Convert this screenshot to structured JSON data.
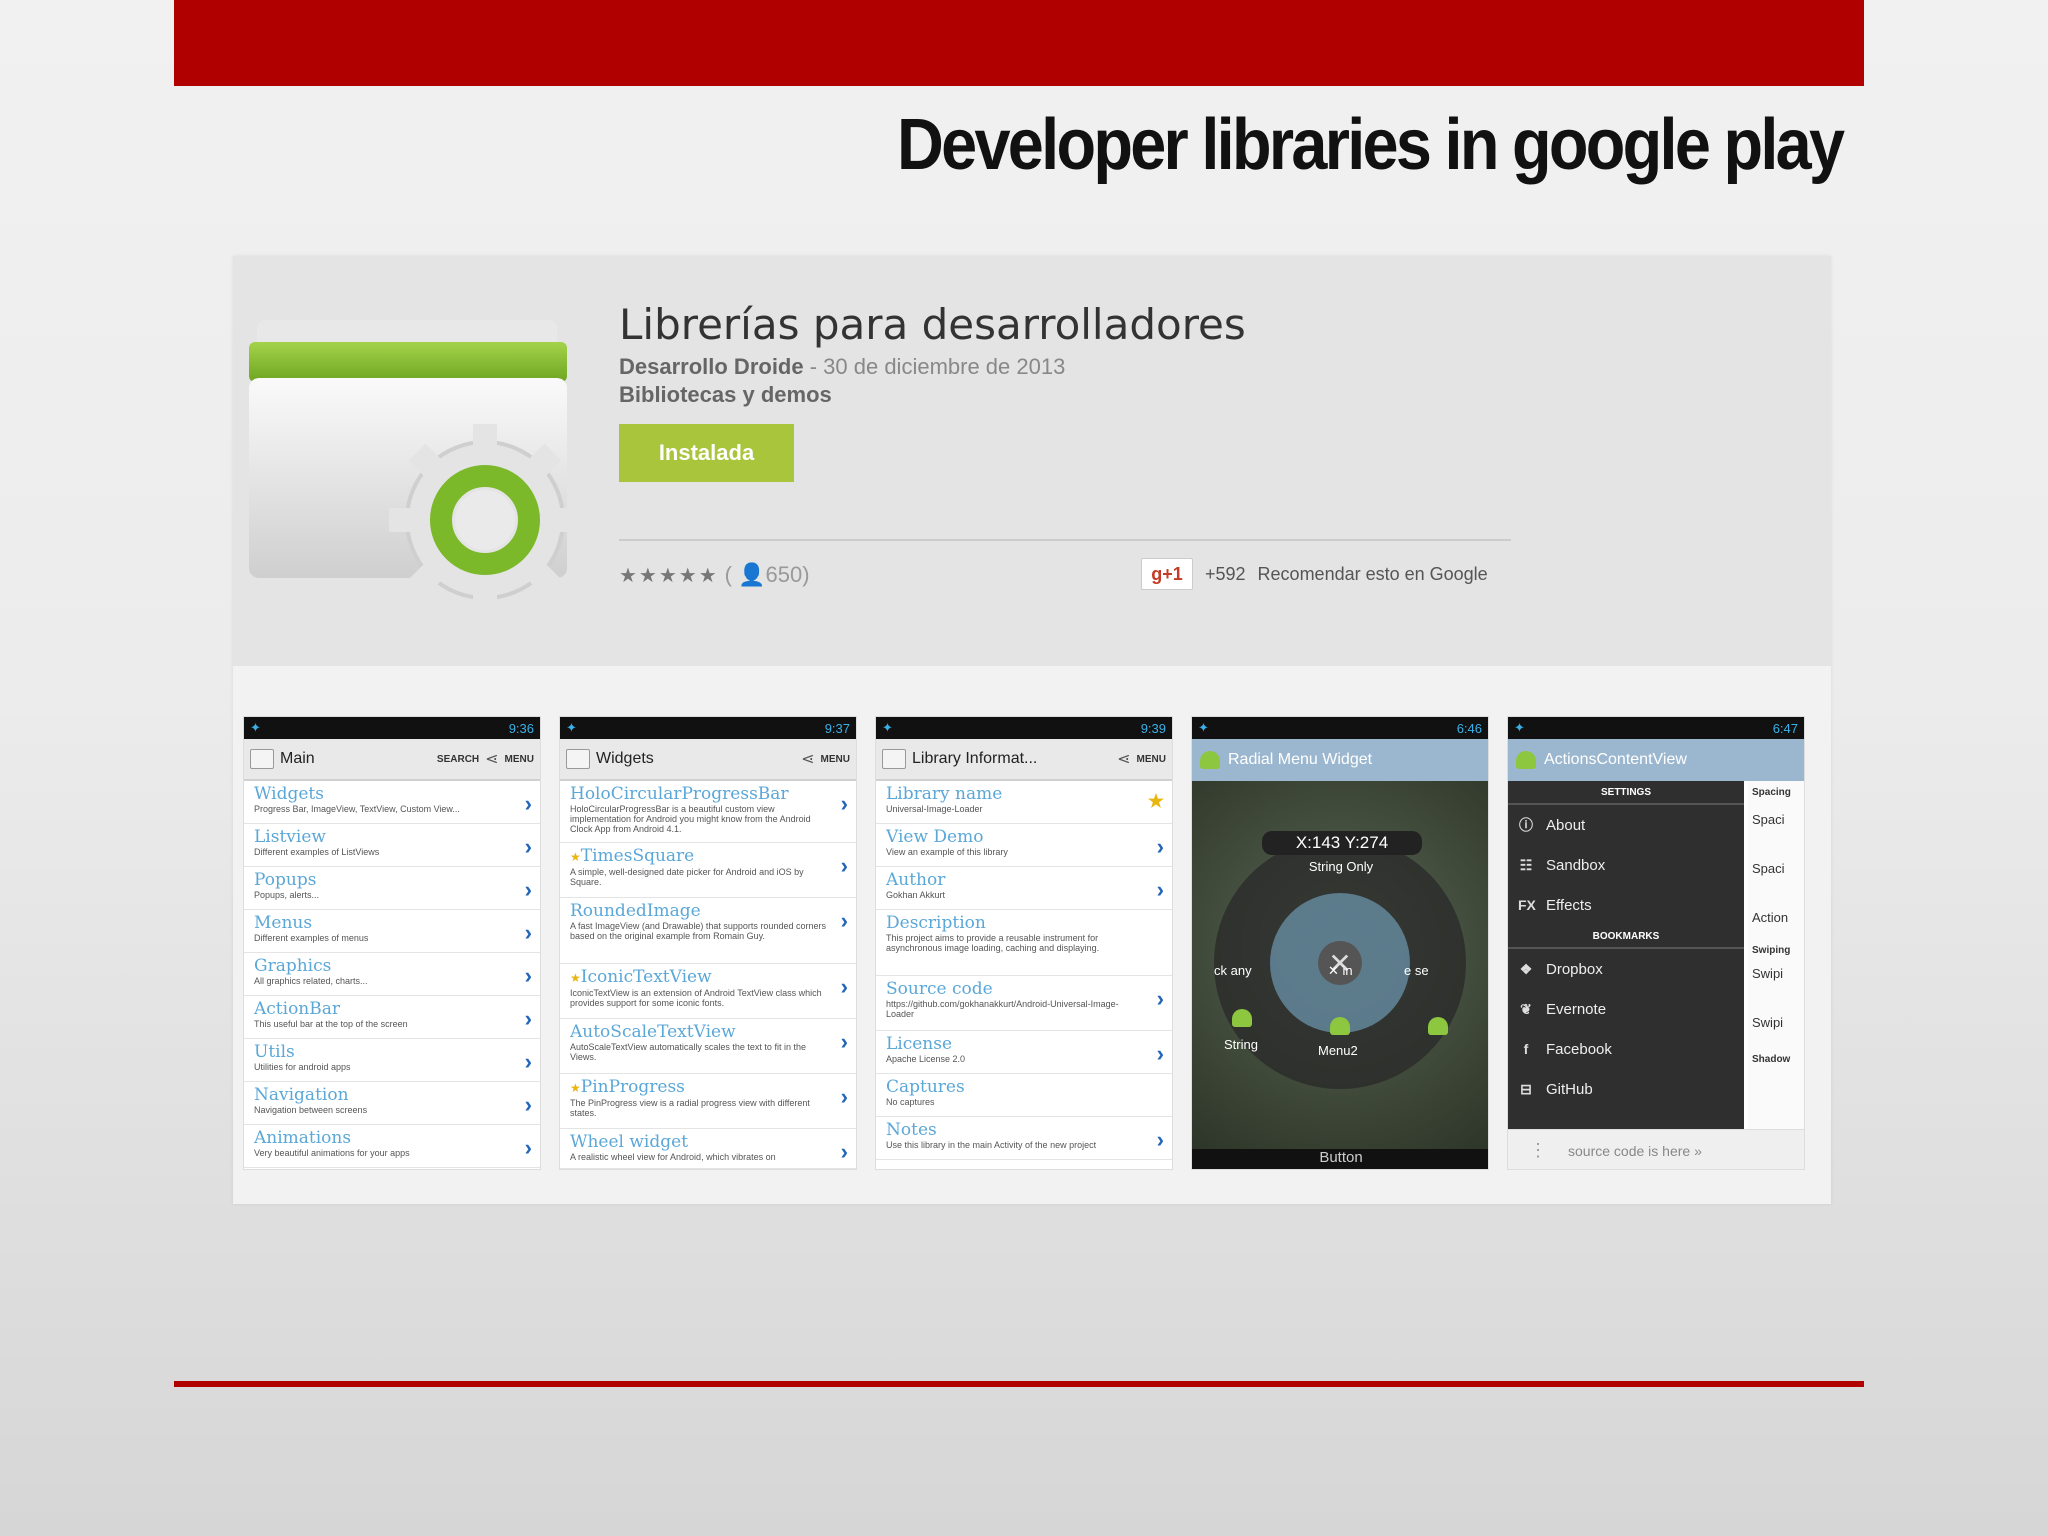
{
  "slide": {
    "title": "Developer libraries in google play"
  },
  "app": {
    "title": "Librerías para desarrolladores",
    "developer": "Desarrollo Droide",
    "date": " - 30 de diciembre de 2013",
    "category": "Bibliotecas y demos",
    "install_label": "Instalada",
    "stars": "★★★★★",
    "reviews": "( 👤650)",
    "gplus_label": "g+1",
    "plus_count": "+592",
    "recommend": "Recomendar esto en Google"
  },
  "screenshots": {
    "s1": {
      "time": "9:36",
      "title": "Main",
      "search": "SEARCH",
      "menu": "MENU",
      "items": [
        {
          "t": "Widgets",
          "d": "Progress Bar, ImageView, TextView, Custom View..."
        },
        {
          "t": "Listview",
          "d": "Different examples of ListViews"
        },
        {
          "t": "Popups",
          "d": "Popups, alerts..."
        },
        {
          "t": "Menus",
          "d": "Different examples of menus"
        },
        {
          "t": "Graphics",
          "d": "All graphics related, charts..."
        },
        {
          "t": "ActionBar",
          "d": "This useful bar at the top of the screen"
        },
        {
          "t": "Utils",
          "d": "Utilities for android apps"
        },
        {
          "t": "Navigation",
          "d": "Navigation between screens"
        },
        {
          "t": "Animations",
          "d": "Very beautiful animations for your apps"
        }
      ]
    },
    "s2": {
      "time": "9:37",
      "title": "Widgets",
      "menu": "MENU",
      "items": [
        {
          "t": "HoloCircularProgressBar",
          "d": "HoloCircularProgressBar is a beautiful custom view implementation for Android you might know from the Android Clock App from Android 4.1."
        },
        {
          "t": "TimesSquare",
          "d": "A simple, well-designed date picker for Android and iOS by Square."
        },
        {
          "t": "RoundedImage",
          "d": "A fast ImageView (and Drawable) that supports rounded corners based on the original example from Romain Guy."
        },
        {
          "t": "IconicTextView",
          "d": "IconicTextView is an extension of Android TextView class which provides support for some iconic fonts."
        },
        {
          "t": "AutoScaleTextView",
          "d": "AutoScaleTextView automatically scales the text to fit in the Views."
        },
        {
          "t": "PinProgress",
          "d": "The PinProgress view is a radial progress view with different states."
        },
        {
          "t": "Wheel widget",
          "d": "A realistic wheel view for Android, which vibrates on"
        }
      ]
    },
    "s3": {
      "time": "9:39",
      "title": "Library Informat...",
      "menu": "MENU",
      "items": [
        {
          "t": "Library name",
          "d": "Universal-Image-Loader"
        },
        {
          "t": "View Demo",
          "d": "View an example of this library"
        },
        {
          "t": "Author",
          "d": "Gokhan Akkurt"
        },
        {
          "t": "Description",
          "d": "This project aims to provide a reusable instrument for asynchronous image loading, caching and displaying."
        },
        {
          "t": "Source code",
          "d": "https://github.com/gokhanakkurt/Android-Universal-Image-Loader"
        },
        {
          "t": "License",
          "d": "Apache License 2.0"
        },
        {
          "t": "Captures",
          "d": "No captures"
        },
        {
          "t": "Notes",
          "d": "Use this library in the main Activity of the new project"
        }
      ]
    },
    "s4": {
      "time": "6:46",
      "title": "Radial Menu Widget",
      "coord": "X:143 Y:274",
      "string_only": "String Only",
      "string": "String",
      "menu2": "Menu2",
      "button": "Button",
      "any": "ck any",
      "xin": "✕ in",
      "ise": "e se"
    },
    "s5": {
      "time": "6:47",
      "title": "ActionsContentView",
      "settings": "SETTINGS",
      "bookmarks": "BOOKMARKS",
      "menu_items": [
        "About",
        "Sandbox",
        "Effects"
      ],
      "bookmark_items": [
        "Dropbox",
        "Evernote",
        "Facebook",
        "GitHub"
      ],
      "right_col": [
        "Spacing",
        "Spaci",
        "Spaci",
        "Action",
        "Swiping",
        "Swipi",
        "Swipi",
        "Shadow"
      ],
      "source": "source code is here »"
    }
  },
  "colors": {
    "accent": "#b00000",
    "install": "#a9c53b",
    "list_title": "#5aa7d8"
  }
}
